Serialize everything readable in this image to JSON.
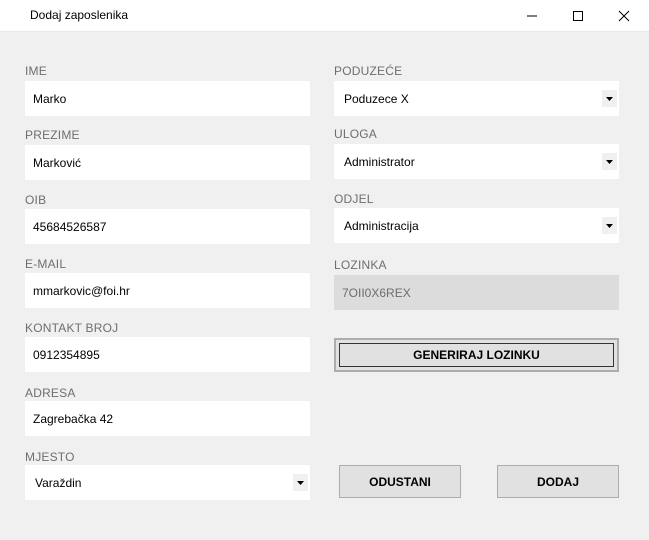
{
  "window": {
    "title": "Dodaj zaposlenika"
  },
  "left": {
    "ime": {
      "label": "IME",
      "value": "Marko"
    },
    "prezime": {
      "label": "PREZIME",
      "value": "Marković"
    },
    "oib": {
      "label": "OIB",
      "value": "45684526587"
    },
    "email": {
      "label": "E-MAIL",
      "value": "mmarkovic@foi.hr"
    },
    "kontakt": {
      "label": "KONTAKT BROJ",
      "value": "0912354895"
    },
    "adresa": {
      "label": "ADRESA",
      "value": "Zagrebačka 42"
    },
    "mjesto": {
      "label": "MJESTO",
      "value": "Varaždin"
    }
  },
  "right": {
    "poduzece": {
      "label": "PODUZEĆE",
      "value": "Poduzece X"
    },
    "uloga": {
      "label": "ULOGA",
      "value": "Administrator"
    },
    "odjel": {
      "label": "ODJEL",
      "value": "Administracija"
    },
    "lozinka": {
      "label": "LOZINKA",
      "value": "7OII0X6REX"
    }
  },
  "buttons": {
    "generate": "GENERIRAJ LOZINKU",
    "cancel": "ODUSTANI",
    "add": "DODAJ"
  },
  "icons": {
    "minimize": "minimize-icon",
    "maximize": "maximize-icon",
    "close": "close-icon",
    "dropdown": "dropdown-arrow-icon"
  }
}
